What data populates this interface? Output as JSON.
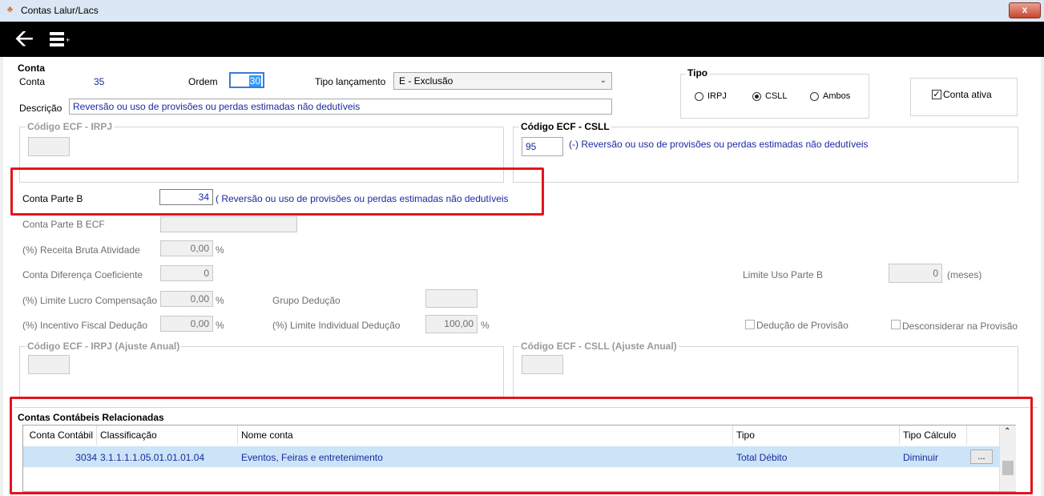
{
  "window": {
    "title": "Contas Lalur/Lacs",
    "close": "x"
  },
  "toolbar": {
    "back_icon": "arrow-left-icon",
    "menu_icon": "list-plus-icon"
  },
  "conta": {
    "section_title": "Conta",
    "conta_label": "Conta",
    "conta_value": "35",
    "ordem_label": "Ordem",
    "ordem_value": "30",
    "tipo_lancamento_label": "Tipo lançamento",
    "tipo_lancamento_value": "E - Exclusão",
    "descricao_label": "Descrição",
    "descricao_value": "Reversão ou uso de provisões ou perdas estimadas não dedutíveis"
  },
  "tipo": {
    "title": "Tipo",
    "options": [
      "IRPJ",
      "CSLL",
      "Ambos"
    ],
    "selected": "CSLL"
  },
  "conta_ativa": {
    "label": "Conta ativa",
    "checked": true
  },
  "ecf_irpj": {
    "title": "Código ECF - IRPJ",
    "value": ""
  },
  "ecf_csll": {
    "title": "Código ECF - CSLL",
    "code": "95",
    "desc": "(-) Reversão ou uso de provisões ou perdas estimadas não dedutíveis"
  },
  "parte_b": {
    "label": "Conta Parte B",
    "value": "34",
    "desc": "( Reversão ou uso de provisões ou perdas estimadas não dedutíveis"
  },
  "fields": {
    "parte_b_ecf_label": "Conta Parte B ECF",
    "parte_b_ecf_value": "",
    "receita_bruta_label": "(%) Receita Bruta Atividade",
    "receita_bruta_value": "0,00",
    "dif_coef_label": "Conta Diferença Coeficiente",
    "dif_coef_value": "0",
    "limite_lucro_label": "(%) Limite Lucro Compensação",
    "limite_lucro_value": "0,00",
    "incentivo_label": "(%) Incentivo Fiscal Dedução",
    "incentivo_value": "0,00",
    "grupo_deducao_label": "Grupo Dedução",
    "grupo_deducao_value": "",
    "limite_indiv_label": "(%) Limite Individual Dedução",
    "limite_indiv_value": "100,00",
    "percent": "%",
    "limite_uso_label": "Limite Uso Parte B",
    "limite_uso_value": "0",
    "meses": "(meses)",
    "deducao_provisao_label": "Dedução de Provisão",
    "desconsiderar_label": "Desconsiderar na Provisão"
  },
  "ecf_irpj_anual": {
    "title": "Código ECF - IRPJ (Ajuste Anual)",
    "value": ""
  },
  "ecf_csll_anual": {
    "title": "Código ECF - CSLL (Ajuste Anual)",
    "value": ""
  },
  "relacionadas": {
    "title": "Contas Contábeis Relacionadas",
    "columns": [
      "Conta Contábil",
      "Classificação",
      "Nome conta",
      "Tipo",
      "Tipo Cálculo"
    ],
    "rows": [
      {
        "conta": "3034",
        "classificacao": "3.1.1.1.1.05.01.01.01.04",
        "nome": "Eventos, Feiras e entretenimento",
        "tipo": "Total Débito",
        "calculo": "Diminuir",
        "btn": "..."
      }
    ]
  },
  "colors": {
    "highlight": "#e4141e",
    "row_selected": "#cce4f7",
    "value_blue": "#1a2aa0"
  }
}
